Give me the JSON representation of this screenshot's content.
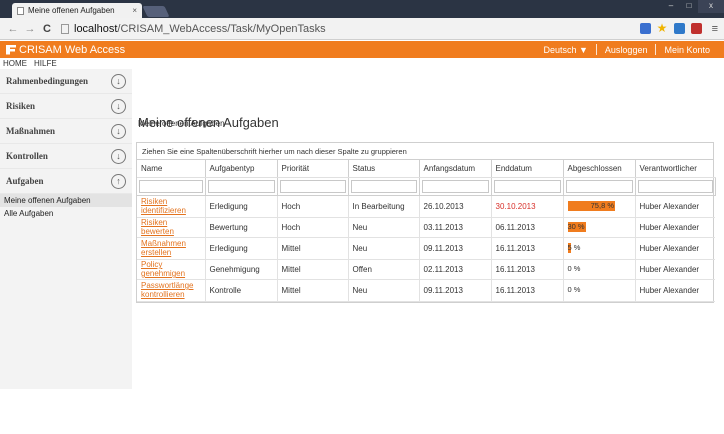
{
  "browser": {
    "tab_title": "Meine offenen Aufgaben",
    "tab_close": "×",
    "url_host": "localhost",
    "url_path": "/CRISAM_WebAccess/Task/MyOpenTasks",
    "window_min": "–",
    "window_max": "□",
    "window_close": "x"
  },
  "app": {
    "brand": "CRISAM Web Access",
    "language": "Deutsch ▼",
    "logout": "Ausloggen",
    "account": "Mein Konto",
    "accent_color": "#f07c1e"
  },
  "submenu": {
    "home": "HOME",
    "help": "HILFE"
  },
  "sidebar": {
    "sections": [
      {
        "label": "Rahmenbedingungen",
        "icon": "chevron-down-circle-icon",
        "glyph": "↓"
      },
      {
        "label": "Risiken",
        "icon": "chevron-down-circle-icon",
        "glyph": "↓"
      },
      {
        "label": "Maßnahmen",
        "icon": "chevron-down-circle-icon",
        "glyph": "↓"
      },
      {
        "label": "Kontrollen",
        "icon": "chevron-down-circle-icon",
        "glyph": "↓"
      },
      {
        "label": "Aufgaben",
        "icon": "chevron-up-circle-icon",
        "glyph": "↑"
      }
    ],
    "items": [
      {
        "label": "Meine offenen Aufgaben",
        "active": true
      },
      {
        "label": "Alle Aufgaben",
        "active": false
      }
    ]
  },
  "main": {
    "breadcrumb": "Meine offenen Aufgaben",
    "title": "Meine offenen Aufgaben",
    "group_hint": "Ziehen Sie eine Spaltenüberschrift hierher um nach dieser Spalte zu gruppieren",
    "columns": [
      "Name",
      "Aufgabentyp",
      "Priorität",
      "Status",
      "Anfangsdatum",
      "Enddatum",
      "Abgeschlossen",
      "Verantwortlicher"
    ],
    "rows": [
      {
        "name": "Risiken identifizieren",
        "type": "Erledigung",
        "priority": "Hoch",
        "status": "In Bearbeitung",
        "start": "26.10.2013",
        "end": "30.10.2013",
        "end_overdue": true,
        "completed_label": "75,8 %",
        "completed_fraction": 0.758,
        "owner": "Huber Alexander"
      },
      {
        "name": "Risiken bewerten",
        "type": "Bewertung",
        "priority": "Hoch",
        "status": "Neu",
        "start": "03.11.2013",
        "end": "06.11.2013",
        "end_overdue": false,
        "completed_label": "30 %",
        "completed_fraction": 0.3,
        "owner": "Huber Alexander"
      },
      {
        "name": "Maßnahmen erstellen",
        "type": "Erledigung",
        "priority": "Mittel",
        "status": "Neu",
        "start": "09.11.2013",
        "end": "16.11.2013",
        "end_overdue": false,
        "completed_label": "5 %",
        "completed_fraction": 0.05,
        "owner": "Huber Alexander"
      },
      {
        "name": "Policy genehmigen",
        "type": "Genehmigung",
        "priority": "Mittel",
        "status": "Offen",
        "start": "02.11.2013",
        "end": "16.11.2013",
        "end_overdue": false,
        "completed_label": "0 %",
        "completed_fraction": 0,
        "owner": "Huber Alexander"
      },
      {
        "name": "Passwortlänge kontrollieren",
        "type": "Kontrolle",
        "priority": "Mittel",
        "status": "Neu",
        "start": "09.11.2013",
        "end": "16.11.2013",
        "end_overdue": false,
        "completed_label": "0 %",
        "completed_fraction": 0,
        "owner": "Huber Alexander"
      }
    ]
  }
}
